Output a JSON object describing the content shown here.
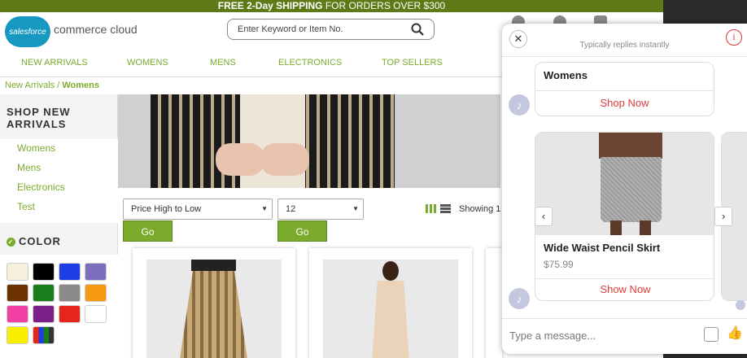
{
  "promo": {
    "bold": "FREE 2-Day SHIPPING",
    "rest": "FOR ORDERS OVER $300"
  },
  "header": {
    "logo_badge": "salesforce",
    "logo_text": "commerce cloud",
    "search_placeholder": "Enter Keyword or Item No."
  },
  "nav": [
    "NEW ARRIVALS",
    "WOMENS",
    "MENS",
    "ELECTRONICS",
    "TOP SELLERS"
  ],
  "breadcrumb": {
    "root": "New Arrivals",
    "sep": "/",
    "current": "Womens"
  },
  "sidebar": {
    "heading": "SHOP NEW ARRIVALS",
    "categories": [
      "Womens",
      "Mens",
      "Electronics",
      "Test"
    ],
    "color_heading": "COLOR",
    "swatches": [
      "#f4f0dc",
      "#000000",
      "#1e3de6",
      "#7d6fbf",
      "#6b3200",
      "#1c7d1c",
      "#8a8a8a",
      "#f59a0f",
      "#f13fa3",
      "#7b1f8a",
      "#e6251b",
      "#ffffff",
      "#f6f000",
      "multi"
    ]
  },
  "sort": {
    "sort_value": "Price High to Low",
    "per_page_value": "12",
    "go_label": "Go",
    "go_label_2": "Go",
    "showing": "Showing 1 -"
  },
  "chat": {
    "status": "Typically replies instantly",
    "info": "i",
    "card1": {
      "title": "Womens",
      "button": "Shop Now"
    },
    "card2": {
      "title": "Wide Waist Pencil Skirt",
      "price": "$75.99",
      "button": "Show Now"
    },
    "compose_placeholder": "Type a message...",
    "colors": {
      "accent": "#e03b3b",
      "brand_green": "#7aab2c"
    }
  }
}
